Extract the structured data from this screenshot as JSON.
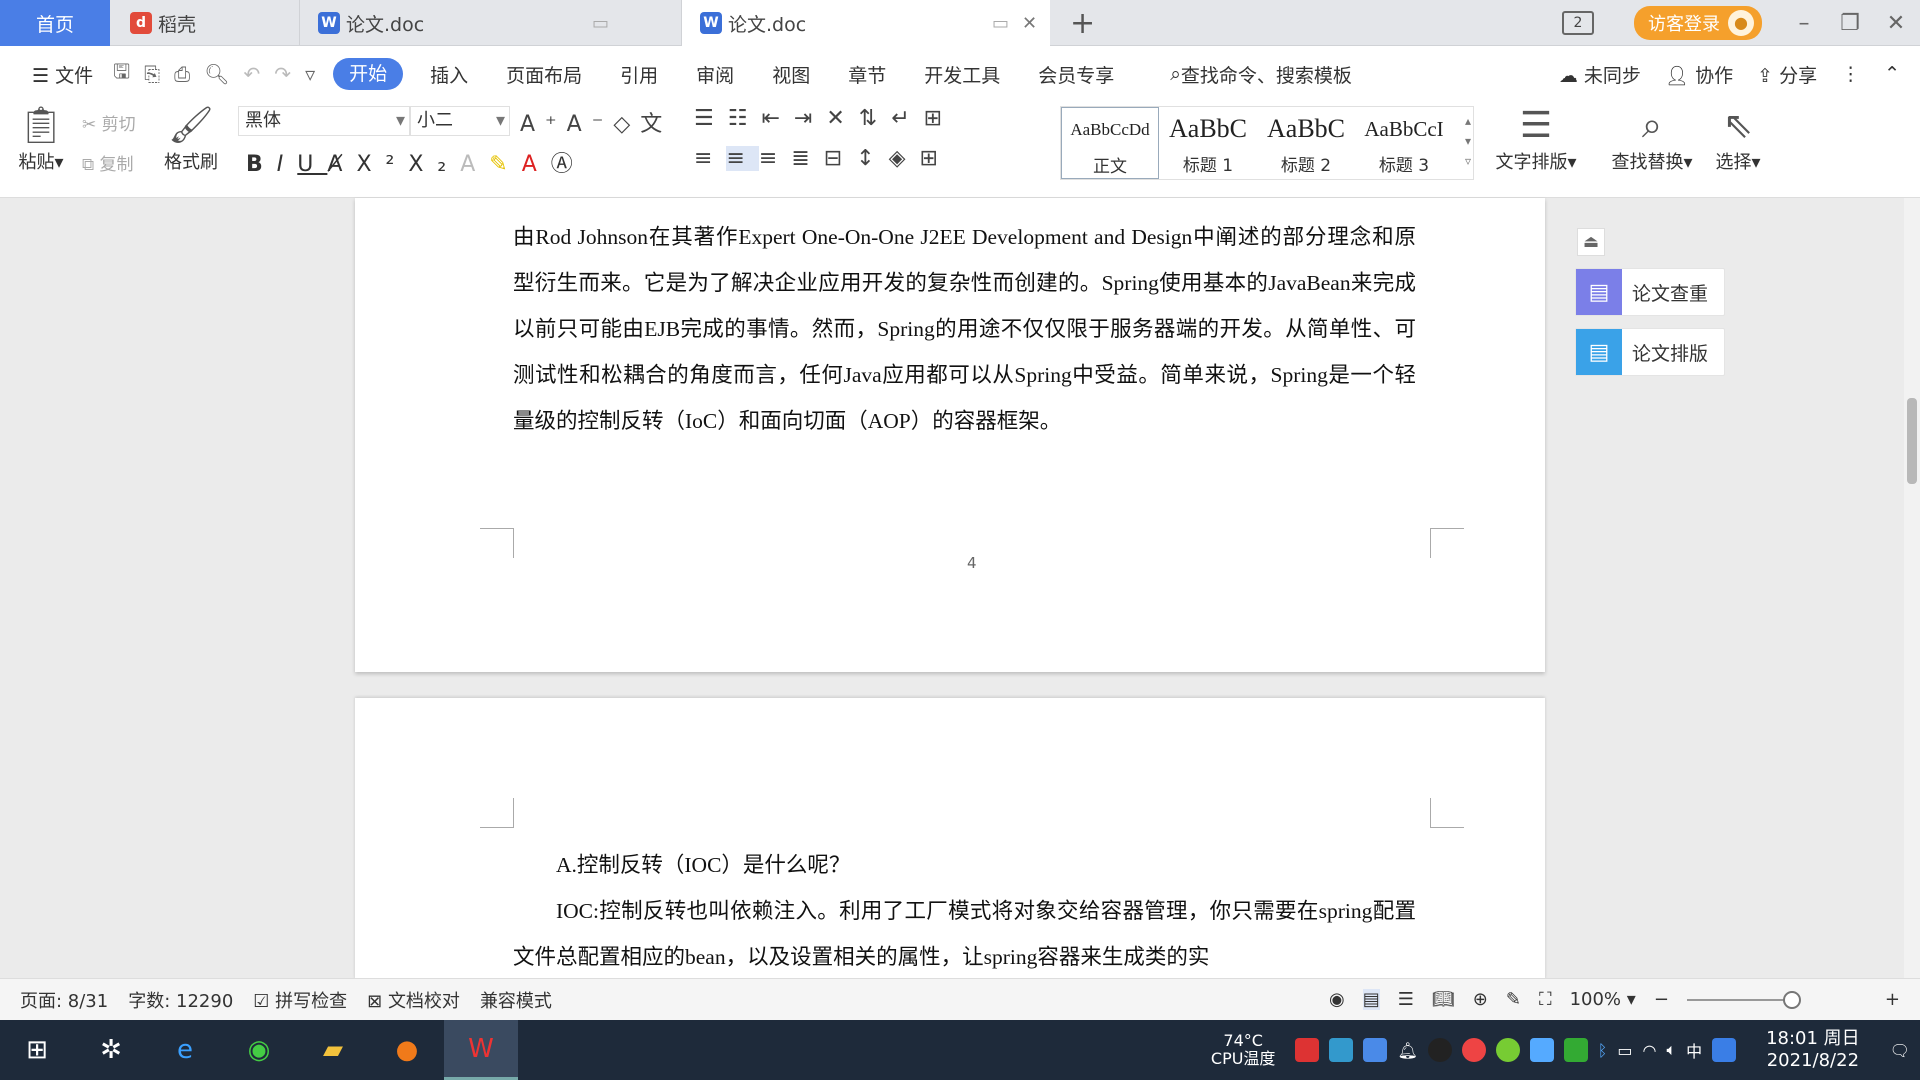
{
  "tabs": {
    "home": "首页",
    "daoke": "稻壳",
    "doc1": "论文.doc",
    "doc2": "论文.doc",
    "login": "访客登录",
    "win_count": "2"
  },
  "menu": {
    "file": "文件",
    "items": [
      "开始",
      "插入",
      "页面布局",
      "引用",
      "审阅",
      "视图",
      "章节",
      "开发工具",
      "会员专享"
    ],
    "search_placeholder": "查找命令、搜索模板",
    "unsync": "未同步",
    "collab": "协作",
    "share": "分享"
  },
  "ribbon": {
    "paste": "粘贴",
    "cut": "剪切",
    "copy": "复制",
    "format_painter": "格式刷",
    "font": "黑体",
    "size": "小二",
    "styles": [
      {
        "preview": "AaBbCcDd",
        "name": "正文"
      },
      {
        "preview": "AaBbC",
        "name": "标题 1"
      },
      {
        "preview": "AaBbC",
        "name": "标题 2"
      },
      {
        "preview": "AaBbCcI",
        "name": "标题 3"
      }
    ],
    "text_layout": "文字排版",
    "find_replace": "查找替换",
    "select": "选择"
  },
  "document": {
    "page1_text": "由Rod Johnson在其著作Expert One-On-One J2EE Development and Design中阐述的部分理念和原型衍生而来。它是为了解决企业应用开发的复杂性而创建的。Spring使用基本的JavaBean来完成以前只可能由EJB完成的事情。然而，Spring的用途不仅仅限于服务器端的开发。从简单性、可测试性和松耦合的角度而言，任何Java应用都可以从Spring中受益。简单来说，Spring是一个轻量级的控制反转（IoC）和面向切面（AOP）的容器框架。",
    "page_number": "4",
    "page2_heading": "A.控制反转（IOC）是什么呢？",
    "page2_text": "IOC:控制反转也叫依赖注入。利用了工厂模式将对象交给容器管理，你只需要在spring配置文件总配置相应的bean，以及设置相关的属性，让spring容器来生成类的实"
  },
  "side_panel": {
    "check": "论文查重",
    "layout": "论文排版"
  },
  "status": {
    "page": "页面: 8/31",
    "words": "字数: 12290",
    "spell": "拼写检查",
    "proof": "文档校对",
    "compat": "兼容模式",
    "zoom": "100%"
  },
  "taskbar": {
    "cpu_temp": "74°C",
    "cpu_label": "CPU温度",
    "ime": "中",
    "time": "18:01 周日",
    "date": "2021/8/22"
  }
}
